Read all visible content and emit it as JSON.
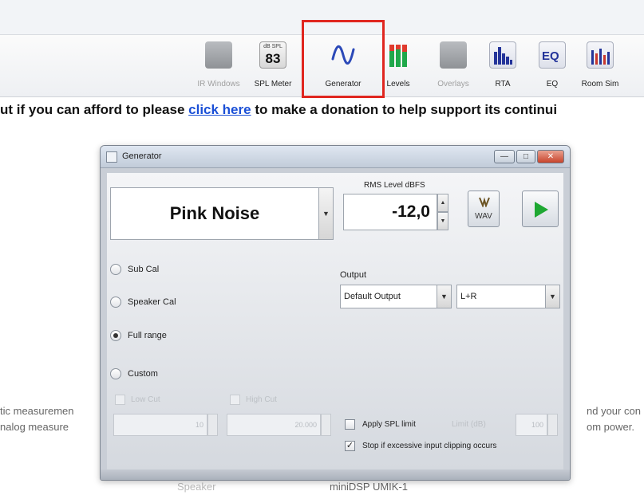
{
  "toolbar": {
    "items": [
      {
        "label": "IR Windows",
        "icon": "ir-windows-icon",
        "enabled": false
      },
      {
        "label": "SPL Meter",
        "icon": "spl-meter-icon",
        "enabled": true,
        "badge_top": "dB SPL",
        "badge_value": "83"
      },
      {
        "label": "Generator",
        "icon": "generator-waveform-icon",
        "enabled": true,
        "highlighted": true
      },
      {
        "label": "Levels",
        "icon": "levels-icon",
        "enabled": true
      },
      {
        "label": "Overlays",
        "icon": "overlays-icon",
        "enabled": false
      },
      {
        "label": "RTA",
        "icon": "rta-icon",
        "enabled": true
      },
      {
        "label": "EQ",
        "icon": "eq-icon",
        "enabled": true
      },
      {
        "label": "Room Sim",
        "icon": "room-sim-icon",
        "enabled": true
      }
    ],
    "highlight_color": "#e0261f"
  },
  "banner": {
    "before": "ut if you can afford to please ",
    "link": "click here",
    "after": " to make a donation to help support its continui"
  },
  "background": {
    "left_line1": "tic measuremen",
    "left_line2": "nalog measure",
    "right_line1": "nd your con",
    "right_line2": "om power.",
    "bottom_left": "Speaker",
    "bottom_center": "miniDSP UMIK-1"
  },
  "generator_window": {
    "title": "Generator",
    "window_buttons": {
      "minimize": "—",
      "maximize": "□",
      "close": "✕"
    },
    "signal": {
      "value": "Pink Noise"
    },
    "rms": {
      "label": "RMS Level dBFS",
      "value": "-12,0"
    },
    "wav_label": "WAV",
    "play": {
      "icon": "play-icon",
      "color": "#1ea832"
    },
    "radios": [
      {
        "label": "Sub Cal",
        "checked": false
      },
      {
        "label": "Speaker Cal",
        "checked": false
      },
      {
        "label": "Full range",
        "checked": true
      },
      {
        "label": "Custom",
        "checked": false
      }
    ],
    "output": {
      "label": "Output",
      "device": "Default Output",
      "channel": "L+R"
    },
    "low_cut": {
      "label": "Low Cut",
      "value": "10"
    },
    "high_cut": {
      "label": "High Cut",
      "value": "20.000"
    },
    "apply_spl": {
      "label": "Apply SPL limit",
      "checked": false,
      "limit_label": "Limit (dB)",
      "limit_value": "100"
    },
    "stop_clip": {
      "label": "Stop if excessive input clipping occurs",
      "checked": true
    }
  }
}
